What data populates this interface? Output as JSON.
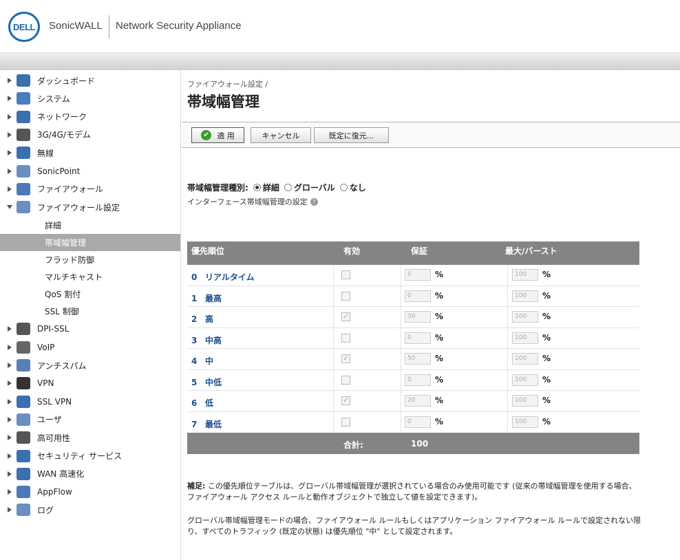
{
  "header": {
    "logo": "DELL",
    "brand": "SonicWALL",
    "product": "Network Security Appliance"
  },
  "sidebar": {
    "items": [
      {
        "label": "ダッシュボード",
        "icon": "dashboard-icon"
      },
      {
        "label": "システム",
        "icon": "system-icon"
      },
      {
        "label": "ネットワーク",
        "icon": "network-icon"
      },
      {
        "label": "3G/4G/モデム",
        "icon": "modem-icon"
      },
      {
        "label": "無線",
        "icon": "wireless-icon"
      },
      {
        "label": "SonicPoint",
        "icon": "sonicpoint-icon"
      },
      {
        "label": "ファイアウォール",
        "icon": "firewall-icon"
      },
      {
        "label": "ファイアウォール設定",
        "icon": "firewall-settings-icon"
      }
    ],
    "subitems": [
      {
        "label": "詳細"
      },
      {
        "label": "帯域幅管理"
      },
      {
        "label": "フラッド防御"
      },
      {
        "label": "マルチキャスト"
      },
      {
        "label": "QoS 割付"
      },
      {
        "label": "SSL 制御"
      }
    ],
    "items2": [
      {
        "label": "DPI-SSL",
        "icon": "dpi-ssl-icon"
      },
      {
        "label": "VoIP",
        "icon": "voip-icon"
      },
      {
        "label": "アンチスパム",
        "icon": "antispam-icon"
      },
      {
        "label": "VPN",
        "icon": "vpn-icon"
      },
      {
        "label": "SSL VPN",
        "icon": "ssl-vpn-icon"
      },
      {
        "label": "ユーザ",
        "icon": "users-icon"
      },
      {
        "label": "高可用性",
        "icon": "high-availability-icon"
      },
      {
        "label": "セキュリティ サービス",
        "icon": "security-services-icon"
      },
      {
        "label": "WAN 高速化",
        "icon": "wan-acceleration-icon"
      },
      {
        "label": "AppFlow",
        "icon": "appflow-icon"
      },
      {
        "label": "ログ",
        "icon": "log-icon"
      }
    ]
  },
  "main": {
    "breadcrumb": "ファイアウォール設定 /",
    "title": "帯域幅管理",
    "toolbar": {
      "apply": "適 用",
      "cancel": "キャンセル",
      "restore": "既定に復元..."
    },
    "bw_type": {
      "label": "帯域幅管理種別:",
      "options": [
        "詳細",
        "グローバル",
        "なし"
      ],
      "selected": "詳細"
    },
    "iface_setting": "インターフェース帯域幅管理の設定",
    "table": {
      "headers": {
        "priority": "優先順位",
        "enabled": "有効",
        "guaranteed": "保証",
        "max_burst": "最大/バースト"
      },
      "rows": [
        {
          "num": "0",
          "name": "リアルタイム",
          "enabled": false,
          "guaranteed": "0",
          "max": "100",
          "pct": "%"
        },
        {
          "num": "1",
          "name": "最高",
          "enabled": false,
          "guaranteed": "0",
          "max": "100",
          "pct": "%"
        },
        {
          "num": "2",
          "name": "高",
          "enabled": true,
          "guaranteed": "30",
          "max": "100",
          "pct": "%"
        },
        {
          "num": "3",
          "name": "中高",
          "enabled": false,
          "guaranteed": "0",
          "max": "100",
          "pct": "%"
        },
        {
          "num": "4",
          "name": "中",
          "enabled": true,
          "guaranteed": "50",
          "max": "100",
          "pct": "%"
        },
        {
          "num": "5",
          "name": "中低",
          "enabled": false,
          "guaranteed": "0",
          "max": "100",
          "pct": "%"
        },
        {
          "num": "6",
          "name": "低",
          "enabled": true,
          "guaranteed": "20",
          "max": "100",
          "pct": "%"
        },
        {
          "num": "7",
          "name": "最低",
          "enabled": false,
          "guaranteed": "0",
          "max": "100",
          "pct": "%"
        }
      ],
      "total_label": "合計:",
      "total_value": "100"
    },
    "note1_label": "補足:",
    "note1": " この優先順位テーブルは、グローバル帯域幅管理が選択されている場合のみ使用可能です (従来の帯域幅管理を使用する場合、ファイアウォール アクセス ルールと動作オブジェクトで独立して値を設定できます)。",
    "note2": "グローバル帯域幅管理モードの場合、ファイアウォール ルールもしくはアプリケーション ファイアウォール ルールで設定されない限り、すべてのトラフィック (既定の状態) は優先順位 \"中\" として設定されます。"
  },
  "colors": {
    "dell_blue": "#1a6ab1",
    "link_blue": "#1d4f8c",
    "table_header": "#848484",
    "active_nav": "#a9a9a9",
    "apply_green": "#3a9b2c"
  }
}
